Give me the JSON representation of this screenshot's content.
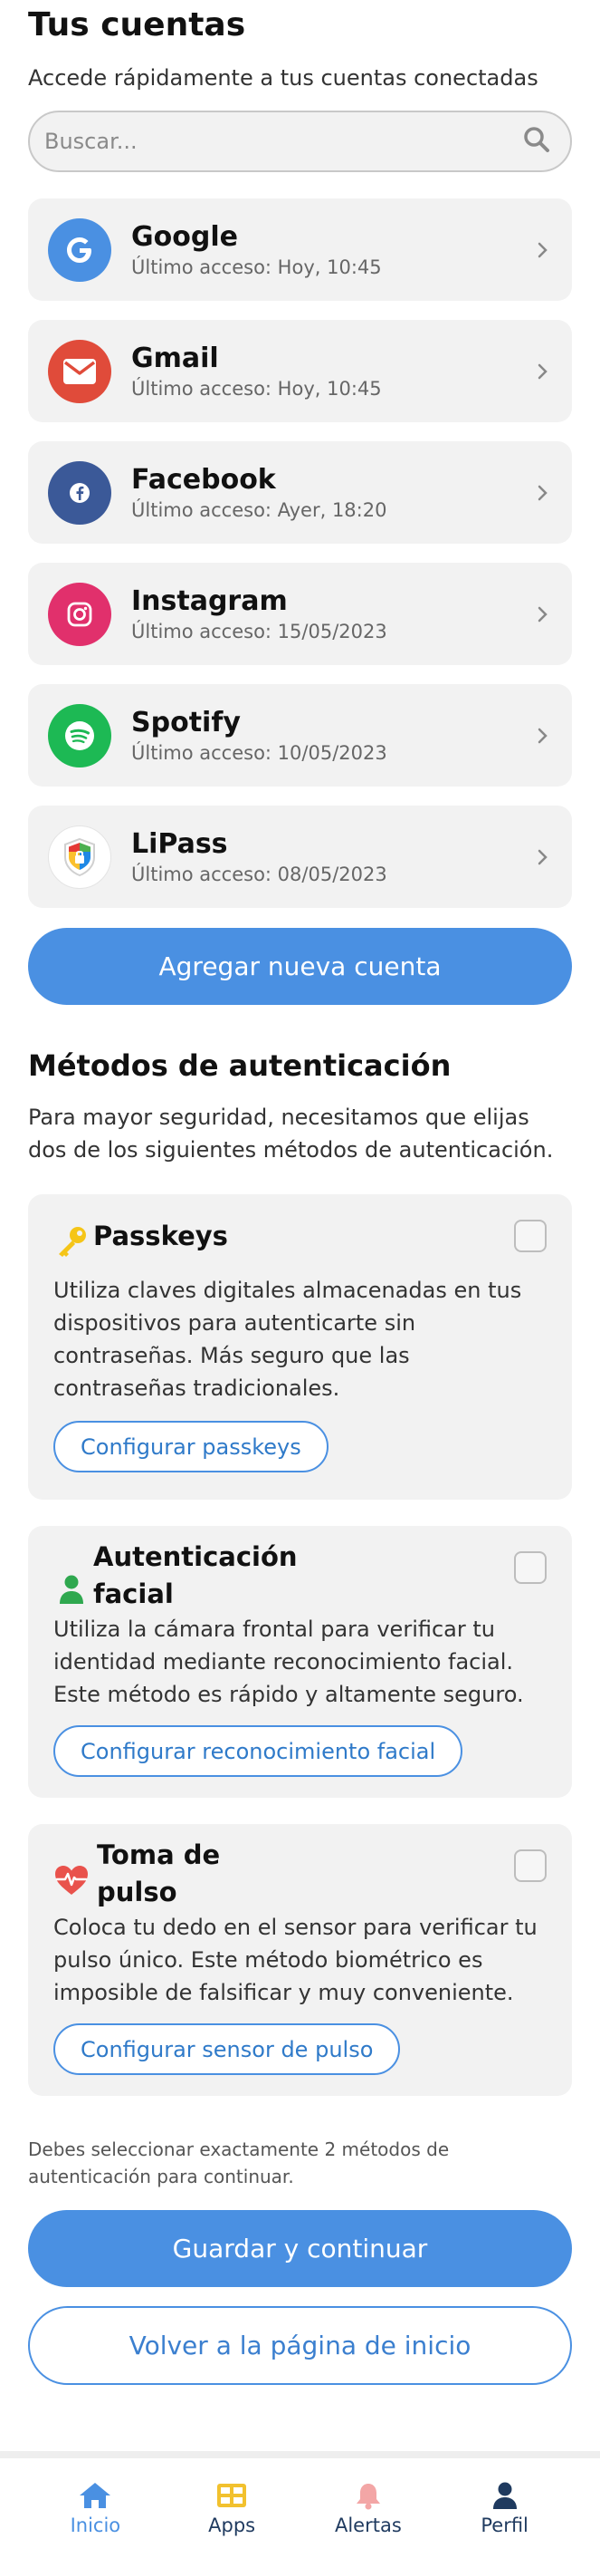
{
  "header": {
    "title": "Tus cuentas",
    "subtitle": "Accede rápidamente a tus cuentas conectadas"
  },
  "search": {
    "placeholder": "Buscar...",
    "icon": "search-icon"
  },
  "accounts": [
    {
      "name": "Google",
      "last_access": "Último acceso: Hoy, 10:45",
      "icon": "google-icon",
      "color": "#4a90e2"
    },
    {
      "name": "Gmail",
      "last_access": "Último acceso: Hoy, 10:45",
      "icon": "mail-icon",
      "color": "#e04b3a"
    },
    {
      "name": "Facebook",
      "last_access": "Último acceso: Ayer, 18:20",
      "icon": "facebook-icon",
      "color": "#3b5998"
    },
    {
      "name": "Instagram",
      "last_access": "Último acceso: 15/05/2023",
      "icon": "instagram-icon",
      "color": "#e1306c"
    },
    {
      "name": "Spotify",
      "last_access": "Último acceso: 10/05/2023",
      "icon": "spotify-icon",
      "color": "#1db954"
    },
    {
      "name": "LiPass",
      "last_access": "Último acceso: 08/05/2023",
      "icon": "lipass-shield-icon",
      "color": "#ffffff"
    }
  ],
  "add_account_label": "Agregar nueva cuenta",
  "auth": {
    "title": "Métodos de autenticación",
    "description": "Para mayor seguridad, necesitamos que elijas dos de los siguientes métodos de autenticación.",
    "methods": [
      {
        "title": "Passkeys",
        "description": "Utiliza claves digitales almacenadas en tus dispositivos para autenticarte sin contraseñas. Más seguro que las contraseñas tradicionales.",
        "button": "Configurar passkeys",
        "icon": "key-icon",
        "checked": false
      },
      {
        "title": "Autenticación facial",
        "description": "Utiliza la cámara frontal para verificar tu identidad mediante reconocimiento facial. Este método es rápido y altamente seguro.",
        "button": "Configurar reconocimiento facial",
        "icon": "person-icon",
        "checked": false
      },
      {
        "title": "Toma de pulso",
        "description": "Coloca tu dedo en el sensor para verificar tu pulso único. Este método biométrico es imposible de falsificar y muy conveniente.",
        "button": "Configurar sensor de pulso",
        "icon": "heart-pulse-icon",
        "checked": false
      }
    ],
    "note": "Debes seleccionar exactamente 2 métodos de autenticación para continuar."
  },
  "save_label": "Guardar y continuar",
  "back_label": "Volver a la página de inicio",
  "nav": [
    {
      "label": "Inicio",
      "icon": "home-icon",
      "color": "#4a90e2",
      "active": true
    },
    {
      "label": "Apps",
      "icon": "apps-grid-icon",
      "color": "#f2c12e",
      "active": false
    },
    {
      "label": "Alertas",
      "icon": "bell-icon",
      "color": "#f3a6a6",
      "active": false
    },
    {
      "label": "Perfil",
      "icon": "user-icon",
      "color": "#1f3a5f",
      "active": false
    }
  ],
  "colors": {
    "primary": "#4a90e2",
    "card_bg": "#f2f2f2"
  }
}
